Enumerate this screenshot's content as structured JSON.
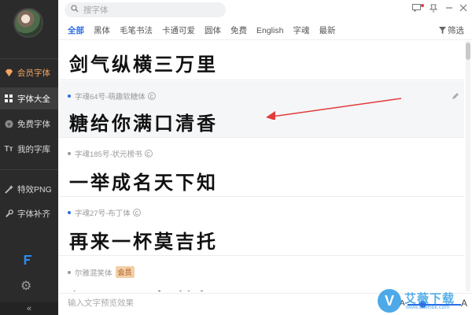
{
  "sidebar": {
    "items": [
      {
        "label": "会员字体",
        "icon": "diamond-icon"
      },
      {
        "label": "字体大全",
        "icon": "grid-icon"
      },
      {
        "label": "免费字体",
        "icon": "coin-icon"
      },
      {
        "label": "我的字库",
        "icon": "font-icon"
      },
      {
        "label": "特效PNG",
        "icon": "magic-wand-icon"
      },
      {
        "label": "字体补齐",
        "icon": "wrench-icon"
      }
    ],
    "collapse_label": "«"
  },
  "search": {
    "placeholder": "搜字体"
  },
  "filters": {
    "items": [
      "全部",
      "黑体",
      "毛笔书法",
      "卡通可爱",
      "圆体",
      "免费",
      "English",
      "字魂",
      "最新"
    ],
    "filter_label": "筛选"
  },
  "fonts": [
    {
      "name": "",
      "preview": "剑气纵横三万里"
    },
    {
      "name": "字魂64号-萌趣软糖体",
      "preview": "糖给你满口清香"
    },
    {
      "name": "字魂185号-状元榜书",
      "preview": "一举成名天下知"
    },
    {
      "name": "字魂27号-布丁体",
      "preview": "再来一杯莫吉托"
    },
    {
      "name": "尔雅混笑体",
      "badge": "会员",
      "preview": "都是是见朝梦想"
    }
  ],
  "bottom": {
    "input_placeholder": "输入文字预览效果",
    "size_small": "A",
    "size_large": "A"
  },
  "watermark": {
    "title": "艾薇下载",
    "url": "www.aiweibk.com"
  },
  "colors": {
    "accent": "#2b6de5",
    "sidebar_bg": "#2b2b2b",
    "vip": "#f2a462",
    "arrow": "#e23b3b"
  }
}
